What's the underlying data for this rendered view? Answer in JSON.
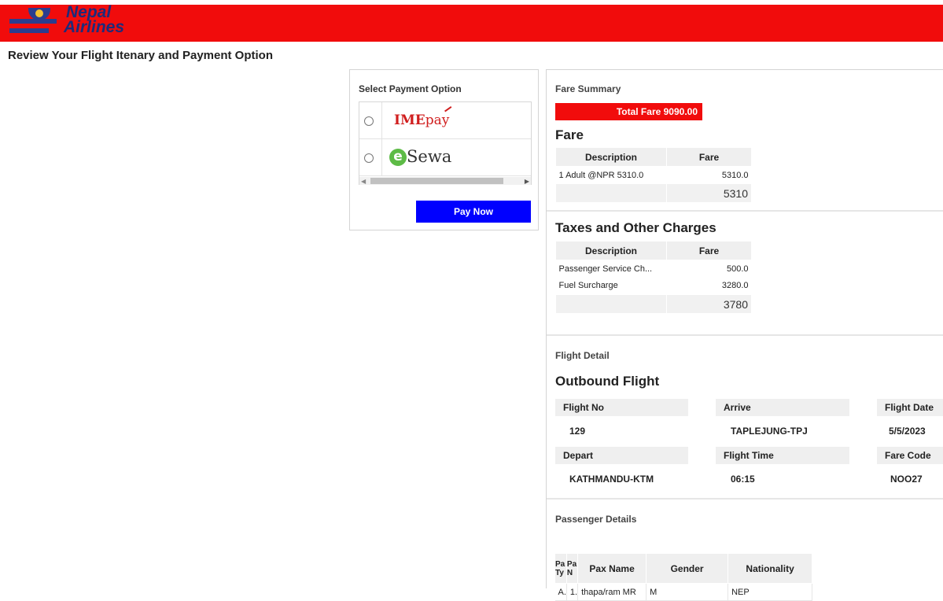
{
  "header": {
    "logo_line1": "Nepal",
    "logo_line2": "Airlines",
    "brand_color": "#f10c0c"
  },
  "page_title": "Review Your Flight Itenary and Payment Option",
  "payment": {
    "title": "Select Payment Option",
    "options": [
      {
        "name": "IMEpay",
        "logo_main": "IME",
        "logo_suffix": "pay",
        "icon": "imepay-logo"
      },
      {
        "name": "eSewa",
        "logo_e": "e",
        "logo_text": "Sewa",
        "icon": "esewa-logo"
      }
    ],
    "pay_button": "Pay Now"
  },
  "fare_summary": {
    "label": "Fare Summary",
    "total": "Total Fare 9090.00",
    "fare_heading": "Fare",
    "fare_table": {
      "headers": [
        "Description",
        "Fare"
      ],
      "rows": [
        [
          "1 Adult @NPR 5310.0",
          "5310.0"
        ]
      ],
      "total": "5310"
    },
    "taxes_heading": "Taxes and Other Charges",
    "taxes_table": {
      "headers": [
        "Description",
        "Fare"
      ],
      "rows": [
        [
          "Passenger Service Ch...",
          "500.0"
        ],
        [
          "Fuel Surcharge",
          "3280.0"
        ]
      ],
      "total": "3780"
    }
  },
  "flight_detail": {
    "label": "Flight Detail",
    "heading": "Outbound Flight",
    "flight_no_label": "Flight No",
    "flight_no": "129",
    "arrive_label": "Arrive",
    "arrive": "TAPLEJUNG-TPJ",
    "flight_date_label": "Flight Date",
    "flight_date": "5/5/2023",
    "depart_label": "Depart",
    "depart": "KATHMANDU-KTM",
    "flight_time_label": "Flight Time",
    "flight_time": "06:15",
    "fare_code_label": "Fare Code",
    "fare_code": "NOO27"
  },
  "passenger": {
    "label": "Passenger Details",
    "headers": [
      "Pax Type",
      "Pax No",
      "Pax Name",
      "Gender",
      "Nationality"
    ],
    "header_short": [
      "Pa Ty",
      "Pa N"
    ],
    "rows": [
      [
        "A.",
        "1.",
        "thapa/ram MR",
        "M",
        "NEP"
      ]
    ]
  }
}
